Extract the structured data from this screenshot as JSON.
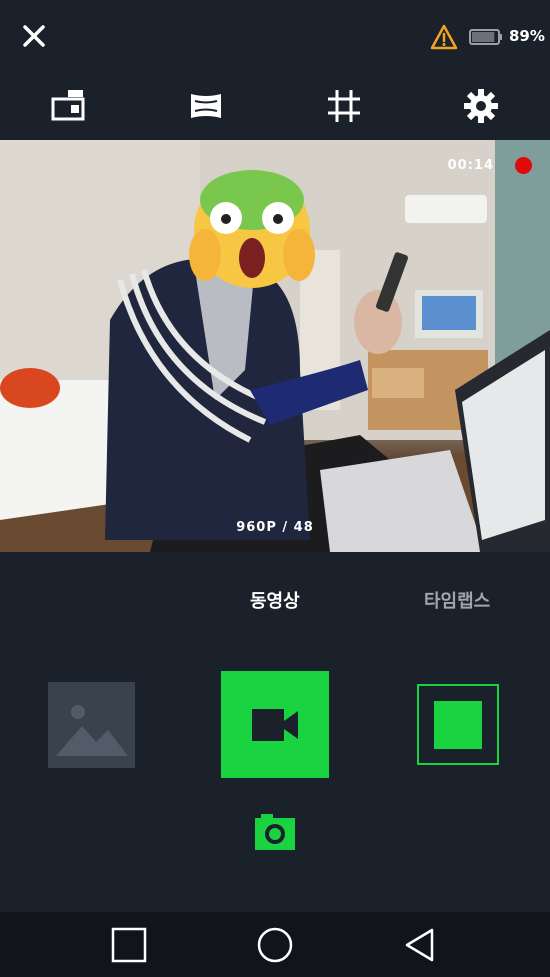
{
  "status": {
    "close_icon": "close-icon",
    "warning_icon": "warning-icon",
    "warning_color": "#f0a322",
    "battery_icon": "battery-icon",
    "battery_text": "89%",
    "battery_level": 0.89
  },
  "toolbar": {
    "items": [
      {
        "icon": "camera-mode-icon"
      },
      {
        "icon": "lens-distortion-icon"
      },
      {
        "icon": "grid-icon"
      },
      {
        "icon": "gear-icon"
      }
    ]
  },
  "preview": {
    "rec_time": "00:14",
    "rec_color": "#e10a0a",
    "resolution": "960P / 48"
  },
  "modes": {
    "active": "동영상",
    "inactive": "타임랩스"
  },
  "controls": {
    "gallery_icon": "gallery-image-icon",
    "record_icon": "video-camera-icon",
    "stop_icon": "stop-icon",
    "photo_icon": "camera-icon",
    "accent": "#19d341"
  },
  "navbar": {
    "items": [
      {
        "icon": "recents-square-icon"
      },
      {
        "icon": "home-circle-icon"
      },
      {
        "icon": "back-triangle-icon"
      }
    ]
  }
}
